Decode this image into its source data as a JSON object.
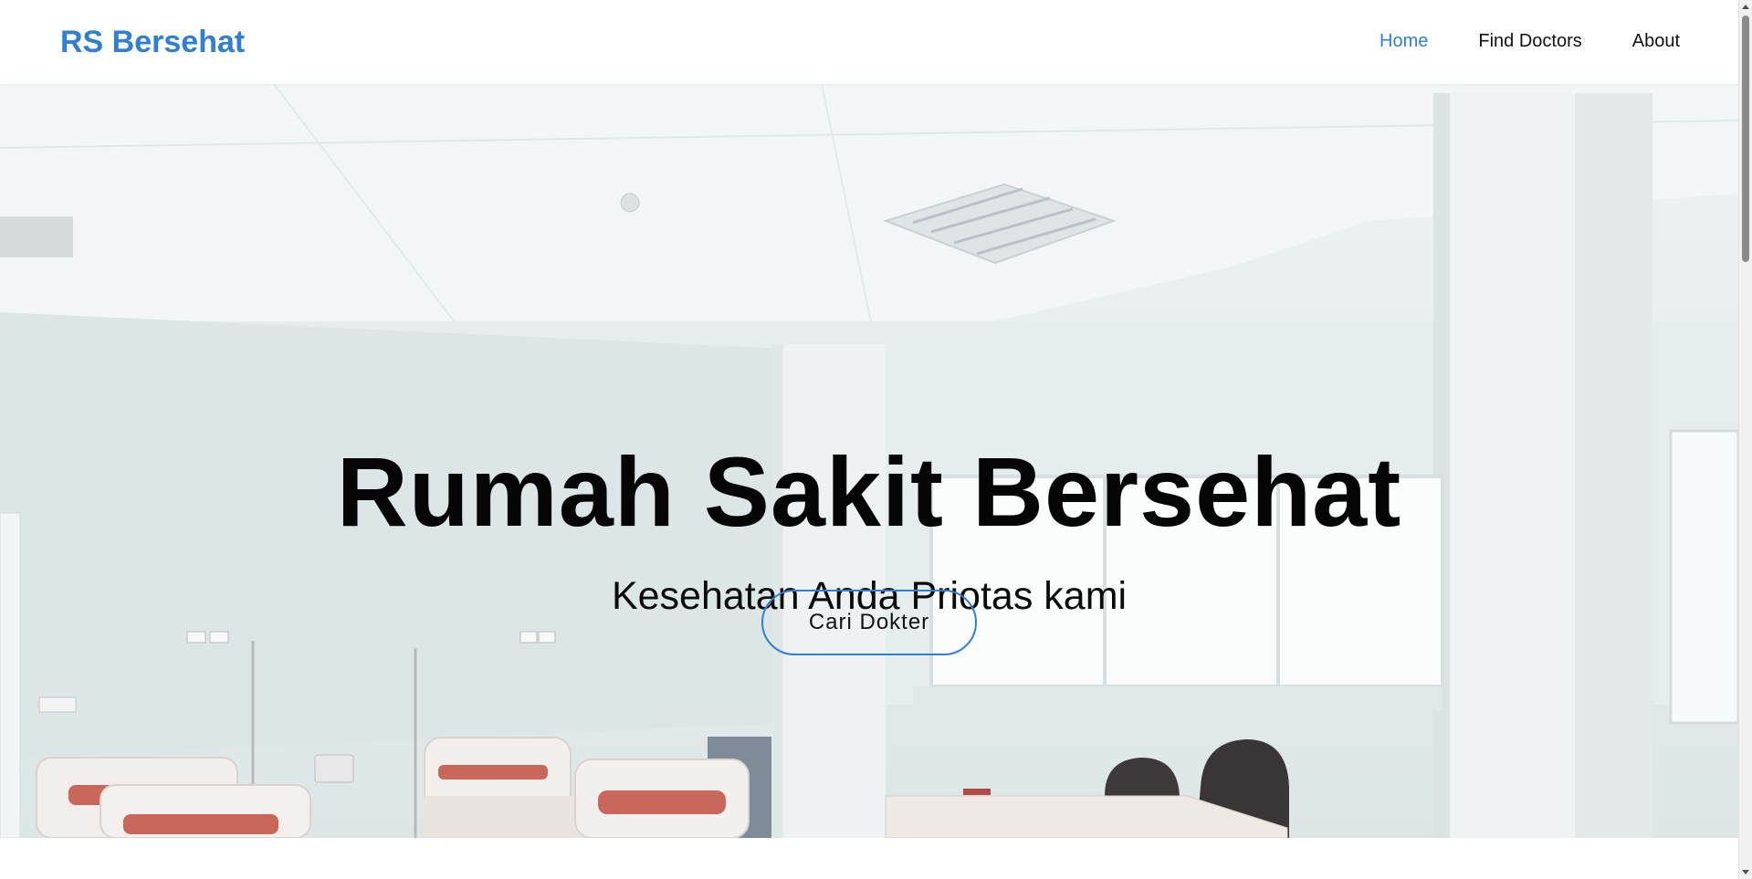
{
  "navbar": {
    "brand": "RS Bersehat",
    "links": [
      {
        "label": "Home",
        "active": true
      },
      {
        "label": "Find Doctors",
        "active": false
      },
      {
        "label": "About",
        "active": false
      }
    ]
  },
  "hero": {
    "title": "Rumah Sakit Bersehat",
    "subtitle": "Kesehatan Anda Priotas kami",
    "button_label": "Cari Dokter",
    "background_image": "hospital-ward-photo"
  },
  "colors": {
    "accent": "#2f7fd6",
    "text": "#111111",
    "background": "#ffffff"
  }
}
